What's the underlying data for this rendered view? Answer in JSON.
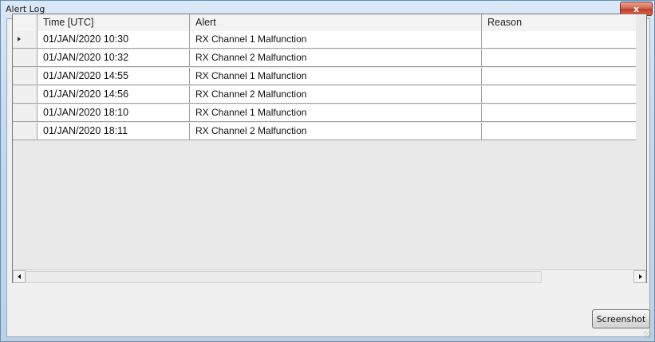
{
  "window": {
    "title": "Alert Log",
    "close_label": "x"
  },
  "grid": {
    "columns": [
      "Time [UTC]",
      "Alert",
      "Reason"
    ],
    "rows": [
      {
        "time": "01/JAN/2020 10:30",
        "alert": "RX Channel 1 Malfunction",
        "reason": "",
        "current": true
      },
      {
        "time": "01/JAN/2020 10:32",
        "alert": "RX Channel 2 Malfunction",
        "reason": ""
      },
      {
        "time": "01/JAN/2020 14:55",
        "alert": "RX Channel 1 Malfunction",
        "reason": ""
      },
      {
        "time": "01/JAN/2020 14:56",
        "alert": "RX Channel 2 Malfunction",
        "reason": ""
      },
      {
        "time": "01/JAN/2020 18:10",
        "alert": "RX Channel 1 Malfunction",
        "reason": ""
      },
      {
        "time": "01/JAN/2020 18:11",
        "alert": "RX Channel 2 Malfunction",
        "reason": ""
      }
    ]
  },
  "footer": {
    "screenshot_label": "Screenshot"
  },
  "icons": {
    "close": "close-icon",
    "row_indicator": "current-row-arrow-icon",
    "scroll_left": "scroll-left-arrow-icon",
    "scroll_right": "scroll-right-arrow-icon"
  }
}
